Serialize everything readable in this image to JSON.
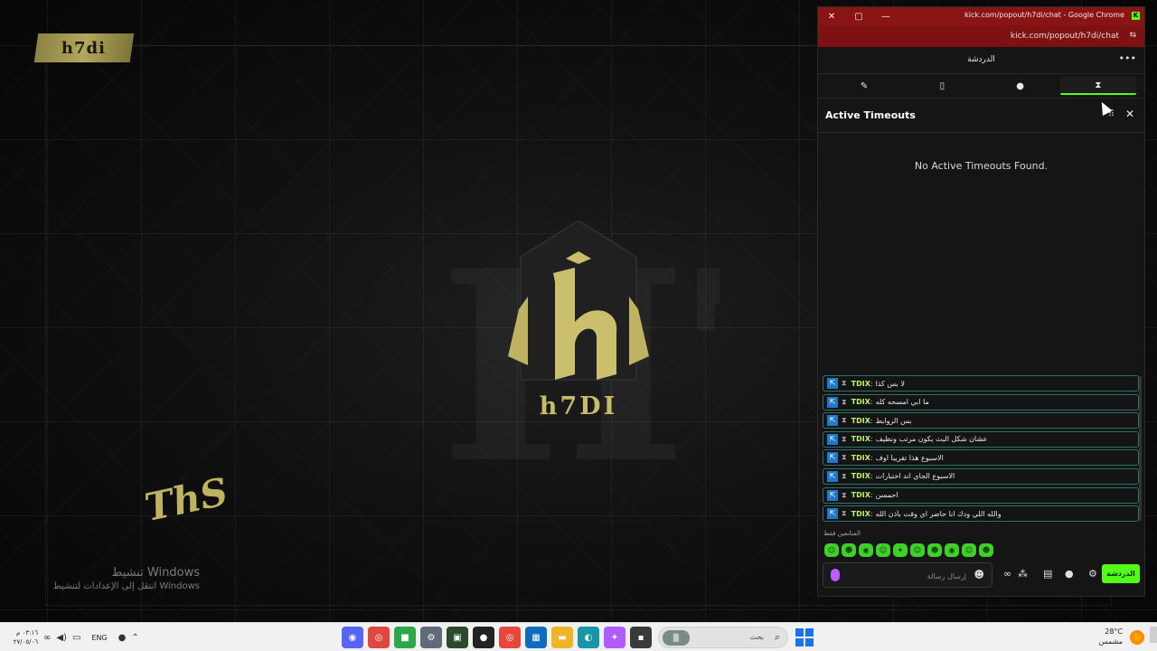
{
  "wallpaper": {
    "brand_tag": "h7di",
    "logo_word": "h7DI",
    "background_letters": "H7DI",
    "signature": "ThS",
    "activation_title": "تنشيط Windows",
    "activation_subtitle": "انتقل إلى الإعدادات لتنشيط Windows"
  },
  "window": {
    "title": "kick.com/popout/h7di/chat - Google Chrome",
    "url": "kick.com/popout/h7di/chat",
    "controls": [
      "close",
      "maximize",
      "minimize"
    ]
  },
  "chat": {
    "header_title": "الدردشة",
    "more_icon": "more-icon",
    "mod_tools": [
      {
        "name": "pin",
        "icon": "✎",
        "active": false
      },
      {
        "name": "delete",
        "icon": "🗑",
        "active": false
      },
      {
        "name": "comment",
        "icon": "●",
        "active": false
      },
      {
        "name": "timeouts",
        "icon": "⧗",
        "active": true
      }
    ],
    "panel_title": "Active Timeouts",
    "empty_message": "No Active Timeouts Found.",
    "messages": [
      {
        "user": "TDIX",
        "text": "لا بس كذا"
      },
      {
        "user": "TDIX",
        "text": "ما ابي امسحه كله"
      },
      {
        "user": "TDIX",
        "text": "بس الروابط"
      },
      {
        "user": "TDIX",
        "text": "عشان شكل البث يكون مرتب ونظيف"
      },
      {
        "user": "TDIX",
        "text": "الاسبوع هذا تقريبا اوف"
      },
      {
        "user": "TDIX",
        "text": "الاسبوع الجاي اند اختبارات"
      },
      {
        "user": "TDIX",
        "text": "احمسن"
      },
      {
        "user": "TDIX",
        "text": "والله اللي ودك انا حاضر اي وقت بأذن الله"
      }
    ],
    "emote_section_title": "المتابعين فقط",
    "emotes": [
      "☺",
      "☻",
      "◉",
      "☺",
      "✦",
      "☺",
      "☻",
      "◉",
      "☺",
      "☻"
    ],
    "input_placeholder": "إرسال رسالة",
    "send_label": "الدردشة",
    "accent": "#53fc18"
  },
  "taskbar": {
    "time": "٠٣:١٦ م",
    "date": "٢٧/٠٥/٠٦",
    "language": "ENG",
    "search_text": "بحث",
    "weather_temp": "28°C",
    "weather_desc": "مشمس",
    "apps": [
      {
        "icon": "discord-icon",
        "color": "#5865f2",
        "glyph": "◉"
      },
      {
        "icon": "chrome-profile-icon",
        "color": "#e0483e",
        "glyph": "◎"
      },
      {
        "icon": "app-icon",
        "color": "#2aa84a",
        "glyph": "■"
      },
      {
        "icon": "settings-icon",
        "color": "#5d6b7a",
        "glyph": "⚙"
      },
      {
        "icon": "terminal-icon",
        "color": "#2d4a2d",
        "glyph": "▣"
      },
      {
        "icon": "obs-icon",
        "color": "#222222",
        "glyph": "●"
      },
      {
        "icon": "chrome-icon",
        "color": "#e8453c",
        "glyph": "◎"
      },
      {
        "icon": "store-icon",
        "color": "#0f6cbd",
        "glyph": "▦"
      },
      {
        "icon": "folder-icon",
        "color": "#f0b429",
        "glyph": "▬"
      },
      {
        "icon": "edge-icon",
        "color": "#1597a8",
        "glyph": "◐"
      },
      {
        "icon": "copilot-icon",
        "color": "#b05cff",
        "glyph": "✦"
      },
      {
        "icon": "notes-icon",
        "color": "#3a3a3a",
        "glyph": "▪"
      }
    ]
  }
}
